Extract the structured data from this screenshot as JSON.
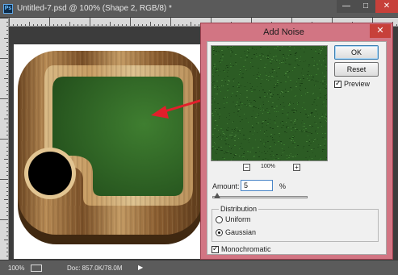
{
  "window": {
    "app_logo": "Ps",
    "title": "Untitled-7.psd @ 100% (Shape 2, RGB/8) *",
    "minimize_icon": "minimize-icon",
    "maximize_icon": "maximize-icon",
    "close_icon": "close-icon"
  },
  "status_bar": {
    "zoom": "100%",
    "doc_info": "Doc: 857.0K/78.0M",
    "menu_icon": "triangle-right-icon"
  },
  "dialog": {
    "title": "Add Noise",
    "close_icon": "close-icon",
    "ok_label": "OK",
    "reset_label": "Reset",
    "preview_label": "Preview",
    "preview_checked": true,
    "preview_zoom": "100%",
    "zoom_out_label": "−",
    "zoom_in_label": "+",
    "amount_label": "Amount:",
    "amount_value": "5",
    "amount_unit": "%",
    "amount_slider_fraction": 0.05,
    "distribution_label": "Distribution",
    "uniform_label": "Uniform",
    "gaussian_label": "Gaussian",
    "selected_distribution": "Gaussian",
    "monochromatic_label": "Monochromatic",
    "monochromatic_checked": true
  },
  "colors": {
    "dialog_frame": "#d27583",
    "felt_green": "#2e6a26",
    "wood_light": "#c9a26b",
    "wood_dark": "#5a3a1c",
    "arrow_red": "#e21f2b"
  }
}
